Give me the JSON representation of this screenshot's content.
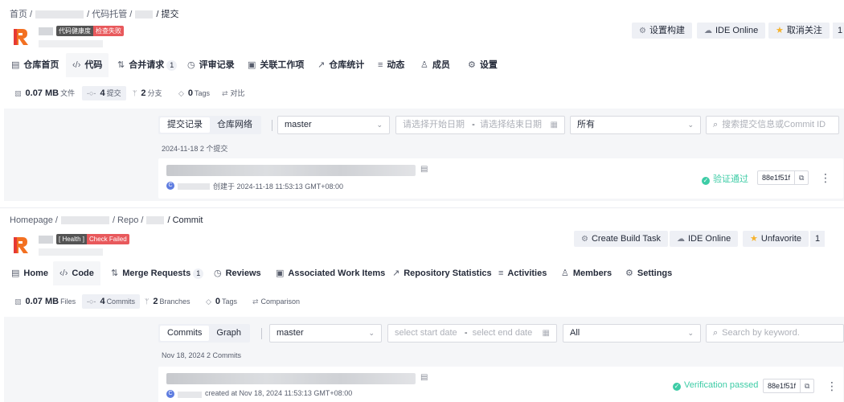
{
  "cn": {
    "breadcrumb": {
      "home": "首页 /",
      "repo": "/ 代码托管 /",
      "current": "/ 提交"
    },
    "badge": {
      "health": "代码健康度",
      "status": "检查失败"
    },
    "buttons": {
      "build": "设置构建",
      "ide": "IDE Online",
      "follow": "取消关注",
      "count": "1"
    },
    "tabs": [
      {
        "label": "仓库首页",
        "icon": "▤"
      },
      {
        "label": "代码",
        "icon": "‹/›"
      },
      {
        "label": "合并请求",
        "icon": "⇅",
        "count": "1"
      },
      {
        "label": "评审记录",
        "icon": "◷"
      },
      {
        "label": "关联工作项",
        "icon": "▣"
      },
      {
        "label": "仓库统计",
        "icon": "↗"
      },
      {
        "label": "动态",
        "icon": "≡"
      },
      {
        "label": "成员",
        "icon": "♙"
      },
      {
        "label": "设置",
        "icon": "⚙"
      }
    ],
    "stats": {
      "size_value": "0.07 MB",
      "size_label": "文件",
      "commits_value": "4",
      "commits_label": "提交",
      "branches_value": "2",
      "branches_label": "分支",
      "tags_value": "0",
      "tags_label": "Tags",
      "compare_label": "对比"
    },
    "filters": {
      "seg_commits": "提交记录",
      "seg_graph": "仓库网络",
      "branch": "master",
      "start_placeholder": "请选择开始日期",
      "dash": "-",
      "end_placeholder": "请选择结束日期",
      "scope": "所有",
      "search_placeholder": "搜索提交信息或Commit ID"
    },
    "date_group": "2024-11-18  2 个提交",
    "commit": {
      "created": "创建于 2024-11-18 11:53:13 GMT+08:00",
      "verify": "验证通过",
      "sha": "88e1f51f"
    }
  },
  "en": {
    "breadcrumb": {
      "home": "Homepage /",
      "repo": "/ Repo /",
      "current": "/ Commit"
    },
    "badge": {
      "health": "[ Health ]",
      "status": "Check Failed"
    },
    "buttons": {
      "build": "Create Build Task",
      "ide": "IDE Online",
      "follow": "Unfavorite",
      "count": "1"
    },
    "tabs": [
      {
        "label": "Home",
        "icon": "▤"
      },
      {
        "label": "Code",
        "icon": "‹/›"
      },
      {
        "label": "Merge Requests",
        "icon": "⇅",
        "count": "1"
      },
      {
        "label": "Reviews",
        "icon": "◷"
      },
      {
        "label": "Associated Work Items",
        "icon": "▣"
      },
      {
        "label": "Repository Statistics",
        "icon": "↗"
      },
      {
        "label": "Activities",
        "icon": "≡"
      },
      {
        "label": "Members",
        "icon": "♙"
      },
      {
        "label": "Settings",
        "icon": "⚙"
      }
    ],
    "stats": {
      "size_value": "0.07 MB",
      "size_label": "Files",
      "commits_value": "4",
      "commits_label": "Commits",
      "branches_value": "2",
      "branches_label": "Branches",
      "tags_value": "0",
      "tags_label": "Tags",
      "compare_label": "Comparison"
    },
    "filters": {
      "seg_commits": "Commits",
      "seg_graph": "Graph",
      "branch": "master",
      "start_placeholder": "select start date",
      "dash": "-",
      "end_placeholder": "select end date",
      "scope": "All",
      "search_placeholder": "Search by keyword."
    },
    "date_group": "Nov 18, 2024  2 Commits",
    "commit": {
      "created": "created at Nov 18, 2024 11:53:13 GMT+08:00",
      "verify": "Verification passed",
      "sha": "88e1f51f"
    }
  },
  "colors": {
    "accent": "#5e7ce0",
    "success": "#3dcca6",
    "danger": "#e8595c",
    "star": "#f6b22c"
  }
}
